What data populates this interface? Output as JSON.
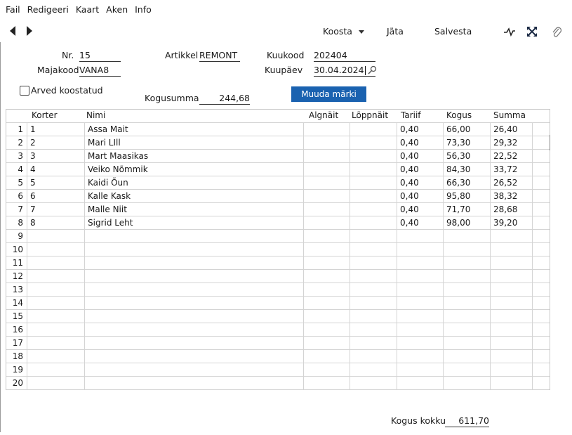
{
  "menu": [
    "Fail",
    "Redigeeri",
    "Kaart",
    "Aken",
    "Info"
  ],
  "toolbar": {
    "koosta_label": "Koosta",
    "jata_label": "Jäta",
    "salvesta_label": "Salvesta"
  },
  "form": {
    "nr_label": "Nr.",
    "nr_value": "15",
    "artikkel_label": "Artikkel",
    "artikkel_value": "REMONT",
    "kuukood_label": "Kuukood",
    "kuukood_value": "202404",
    "majakood_label": "Majakood",
    "majakood_value": "VANA8",
    "kuupaev_label": "Kuupäev",
    "kuupaev_value": "30.04.2024",
    "arved_label": "Arved koostatud",
    "arved_checked": false,
    "kogusumma_label": "Kogusumma",
    "kogusumma_value": "244,68",
    "muuda_label": "Muuda märki"
  },
  "table": {
    "columns": [
      "Korter",
      "Nimi",
      "Algnäit",
      "Lõppnäit",
      "Tariif",
      "Kogus",
      "Summa"
    ],
    "rows": [
      {
        "n": "1",
        "korter": "1",
        "nimi": "Assa Mait",
        "algnait": "",
        "loppnait": "",
        "tariif": "0,40",
        "kogus": "66,00",
        "summa": "26,40"
      },
      {
        "n": "2",
        "korter": "2",
        "nimi": "Mari LIll",
        "algnait": "",
        "loppnait": "",
        "tariif": "0,40",
        "kogus": "73,30",
        "summa": "29,32"
      },
      {
        "n": "3",
        "korter": "3",
        "nimi": "Mart Maasikas",
        "algnait": "",
        "loppnait": "",
        "tariif": "0,40",
        "kogus": "56,30",
        "summa": "22,52"
      },
      {
        "n": "4",
        "korter": "4",
        "nimi": "Veiko Nõmmik",
        "algnait": "",
        "loppnait": "",
        "tariif": "0,40",
        "kogus": "84,30",
        "summa": "33,72"
      },
      {
        "n": "5",
        "korter": "5",
        "nimi": "Kaidi Õun",
        "algnait": "",
        "loppnait": "",
        "tariif": "0,40",
        "kogus": "66,30",
        "summa": "26,52"
      },
      {
        "n": "6",
        "korter": "6",
        "nimi": "Kalle Kask",
        "algnait": "",
        "loppnait": "",
        "tariif": "0,40",
        "kogus": "95,80",
        "summa": "38,32"
      },
      {
        "n": "7",
        "korter": "7",
        "nimi": "Malle Niit",
        "algnait": "",
        "loppnait": "",
        "tariif": "0,40",
        "kogus": "71,70",
        "summa": "28,68"
      },
      {
        "n": "8",
        "korter": "8",
        "nimi": "Sigrid Leht",
        "algnait": "",
        "loppnait": "",
        "tariif": "0,40",
        "kogus": "98,00",
        "summa": "39,20"
      },
      {
        "n": "9",
        "korter": "",
        "nimi": "",
        "algnait": "",
        "loppnait": "",
        "tariif": "",
        "kogus": "",
        "summa": ""
      },
      {
        "n": "10",
        "korter": "",
        "nimi": "",
        "algnait": "",
        "loppnait": "",
        "tariif": "",
        "kogus": "",
        "summa": ""
      },
      {
        "n": "11",
        "korter": "",
        "nimi": "",
        "algnait": "",
        "loppnait": "",
        "tariif": "",
        "kogus": "",
        "summa": ""
      },
      {
        "n": "12",
        "korter": "",
        "nimi": "",
        "algnait": "",
        "loppnait": "",
        "tariif": "",
        "kogus": "",
        "summa": ""
      },
      {
        "n": "13",
        "korter": "",
        "nimi": "",
        "algnait": "",
        "loppnait": "",
        "tariif": "",
        "kogus": "",
        "summa": ""
      },
      {
        "n": "14",
        "korter": "",
        "nimi": "",
        "algnait": "",
        "loppnait": "",
        "tariif": "",
        "kogus": "",
        "summa": ""
      },
      {
        "n": "15",
        "korter": "",
        "nimi": "",
        "algnait": "",
        "loppnait": "",
        "tariif": "",
        "kogus": "",
        "summa": ""
      },
      {
        "n": "16",
        "korter": "",
        "nimi": "",
        "algnait": "",
        "loppnait": "",
        "tariif": "",
        "kogus": "",
        "summa": ""
      },
      {
        "n": "17",
        "korter": "",
        "nimi": "",
        "algnait": "",
        "loppnait": "",
        "tariif": "",
        "kogus": "",
        "summa": ""
      },
      {
        "n": "18",
        "korter": "",
        "nimi": "",
        "algnait": "",
        "loppnait": "",
        "tariif": "",
        "kogus": "",
        "summa": ""
      },
      {
        "n": "19",
        "korter": "",
        "nimi": "",
        "algnait": "",
        "loppnait": "",
        "tariif": "",
        "kogus": "",
        "summa": ""
      },
      {
        "n": "20",
        "korter": "",
        "nimi": "",
        "algnait": "",
        "loppnait": "",
        "tariif": "",
        "kogus": "",
        "summa": ""
      }
    ]
  },
  "footer": {
    "kogus_kokku_label": "Kogus kokku",
    "kogus_kokku_value": "611,70"
  },
  "icons": {
    "back": "left-triangle-icon",
    "forward": "right-triangle-icon",
    "activity": "activity-icon",
    "expand": "expand-icon",
    "attach": "paperclip-icon",
    "search": "magnifier-icon",
    "dropdown": "chevron-down-icon"
  },
  "colors": {
    "accent": "#1a62b0"
  }
}
